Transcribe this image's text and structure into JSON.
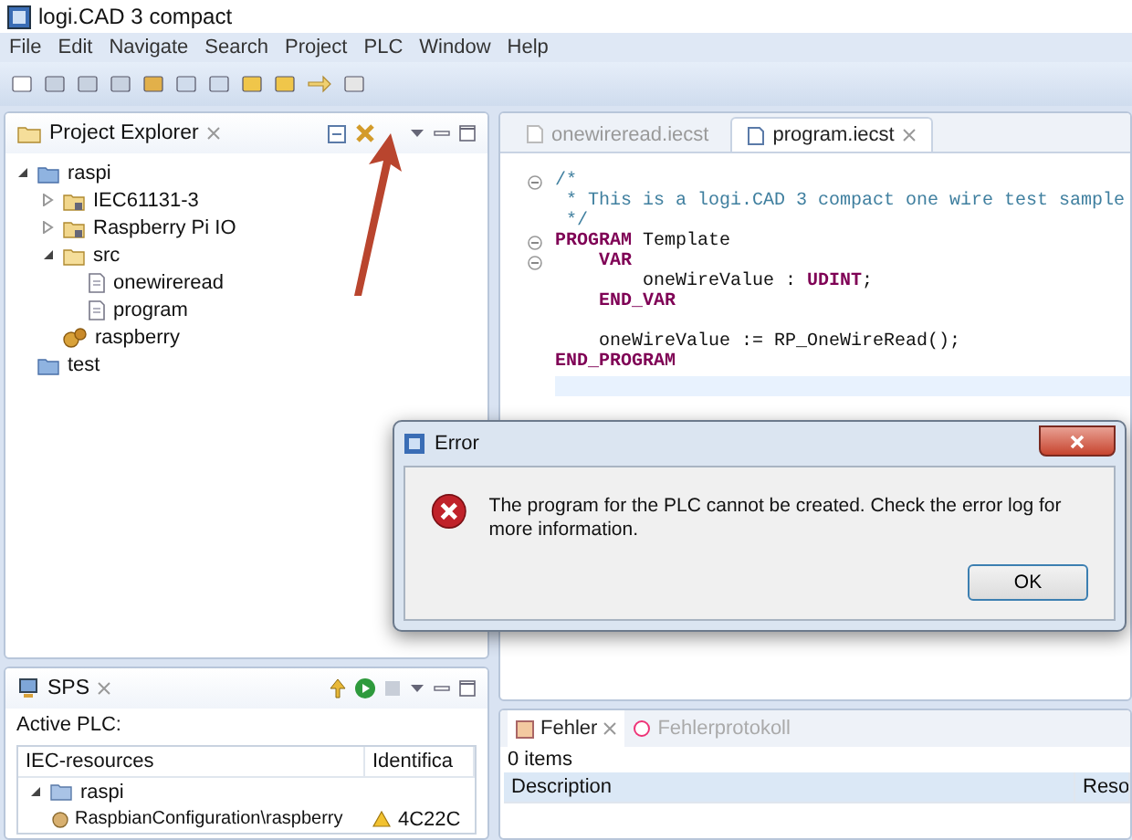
{
  "window": {
    "title": "logi.CAD 3 compact"
  },
  "menu": [
    "File",
    "Edit",
    "Navigate",
    "Search",
    "Project",
    "PLC",
    "Window",
    "Help"
  ],
  "project_explorer": {
    "title": "Project Explorer",
    "tree": [
      {
        "label": "raspi",
        "kind": "project",
        "expanded": true,
        "children": [
          {
            "label": "IEC61131-3",
            "kind": "library",
            "expanded": false
          },
          {
            "label": "Raspberry Pi IO",
            "kind": "library",
            "expanded": false
          },
          {
            "label": "src",
            "kind": "folder",
            "expanded": true,
            "children": [
              {
                "label": "onewireread",
                "kind": "file"
              },
              {
                "label": "program",
                "kind": "file"
              }
            ]
          },
          {
            "label": "raspberry",
            "kind": "config"
          }
        ]
      },
      {
        "label": "test",
        "kind": "project"
      }
    ]
  },
  "editor": {
    "tabs": [
      {
        "label": "onewireread.iecst",
        "selected": false
      },
      {
        "label": "program.iecst",
        "selected": true
      }
    ],
    "lines": [
      {
        "fold": true,
        "tokens": [
          {
            "kind": "comment",
            "text": "/*"
          }
        ]
      },
      {
        "fold": false,
        "tokens": [
          {
            "kind": "comment",
            "text": " * This is a logi.CAD 3 compact one wire test sample"
          }
        ]
      },
      {
        "fold": false,
        "tokens": [
          {
            "kind": "comment",
            "text": " */"
          }
        ]
      },
      {
        "fold": true,
        "tokens": [
          {
            "kind": "keyword",
            "text": "PROGRAM"
          },
          {
            "kind": "plain",
            "text": " Template"
          }
        ]
      },
      {
        "fold": true,
        "tokens": [
          {
            "kind": "keyword",
            "text": "    VAR"
          }
        ]
      },
      {
        "fold": false,
        "tokens": [
          {
            "kind": "plain",
            "text": "        oneWireValue : "
          },
          {
            "kind": "keyword",
            "text": "UDINT"
          },
          {
            "kind": "plain",
            "text": ";"
          }
        ]
      },
      {
        "fold": false,
        "tokens": [
          {
            "kind": "keyword",
            "text": "    END_VAR"
          }
        ]
      },
      {
        "fold": false,
        "kind": "blank"
      },
      {
        "fold": false,
        "tokens": [
          {
            "kind": "plain",
            "text": "    oneWireValue := RP_OneWireRead();"
          }
        ]
      },
      {
        "fold": false,
        "tokens": [
          {
            "kind": "keyword",
            "text": "END_PROGRAM"
          }
        ]
      }
    ]
  },
  "sps": {
    "title": "SPS",
    "label": "Active PLC:",
    "columns": [
      "IEC-resources",
      "Identifica"
    ],
    "rows": [
      {
        "label": "raspi",
        "expanded": true,
        "children": [
          {
            "label": "RaspbianConfiguration\\raspberry",
            "identification": "4C22C",
            "warning": true
          }
        ]
      }
    ]
  },
  "problems": {
    "tabs": [
      {
        "label": "Fehler",
        "selected": true
      },
      {
        "label": "Fehlerprotokoll",
        "selected": false
      }
    ],
    "count": "0 items",
    "columns": [
      "Description",
      "Reso"
    ]
  },
  "dialog": {
    "title": "Error",
    "message": "The program for the PLC cannot be created. Check the error log for more information.",
    "button": "OK"
  }
}
